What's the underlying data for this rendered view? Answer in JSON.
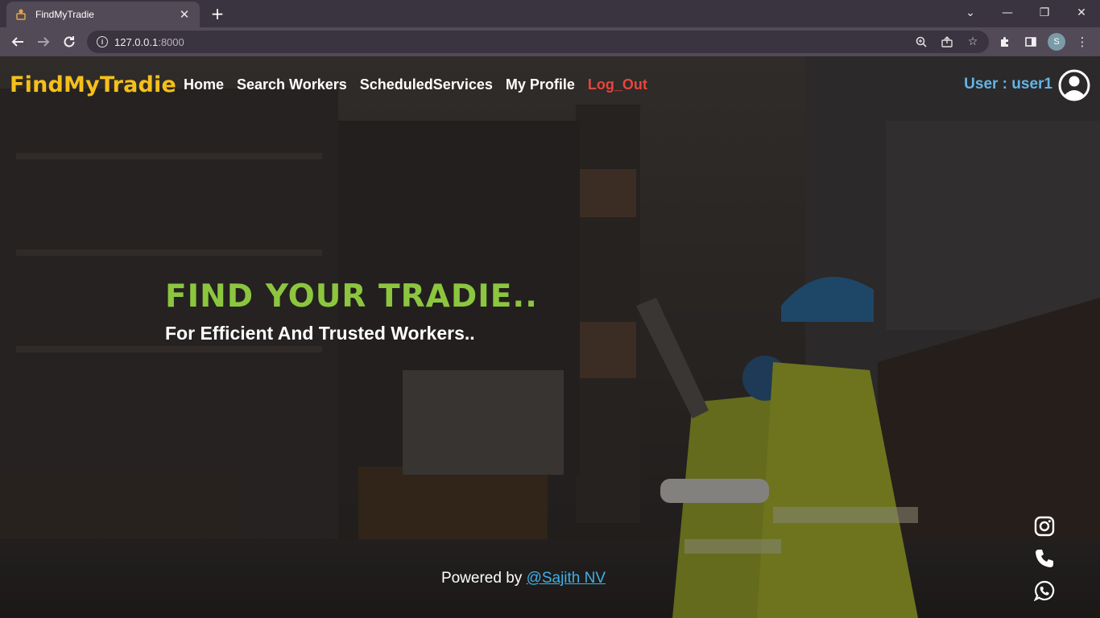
{
  "browser": {
    "tab_title": "FindMyTradie",
    "url_host": "127.0.0.1",
    "url_port": ":8000",
    "profile_initial": "S"
  },
  "navbar": {
    "brand": "FindMyTradie",
    "links": [
      {
        "label": "Home"
      },
      {
        "label": "Search Workers"
      },
      {
        "label": "ScheduledServices"
      },
      {
        "label": "My Profile"
      },
      {
        "label": "Log_Out"
      }
    ],
    "user_label": "User : user1"
  },
  "hero": {
    "title": "FIND YOUR TRADIE..",
    "subtitle": "For Efficient And Trusted Workers.."
  },
  "footer": {
    "powered_text": "Powered by ",
    "author_link": "@Sajith NV"
  },
  "social_icons": [
    "instagram-icon",
    "phone-icon",
    "whatsapp-icon"
  ],
  "colors": {
    "brand": "#f5c01a",
    "hero_title": "#8cc63f",
    "logout": "#e8453c",
    "user_label": "#64b4e6",
    "link": "#3fb0e8"
  }
}
